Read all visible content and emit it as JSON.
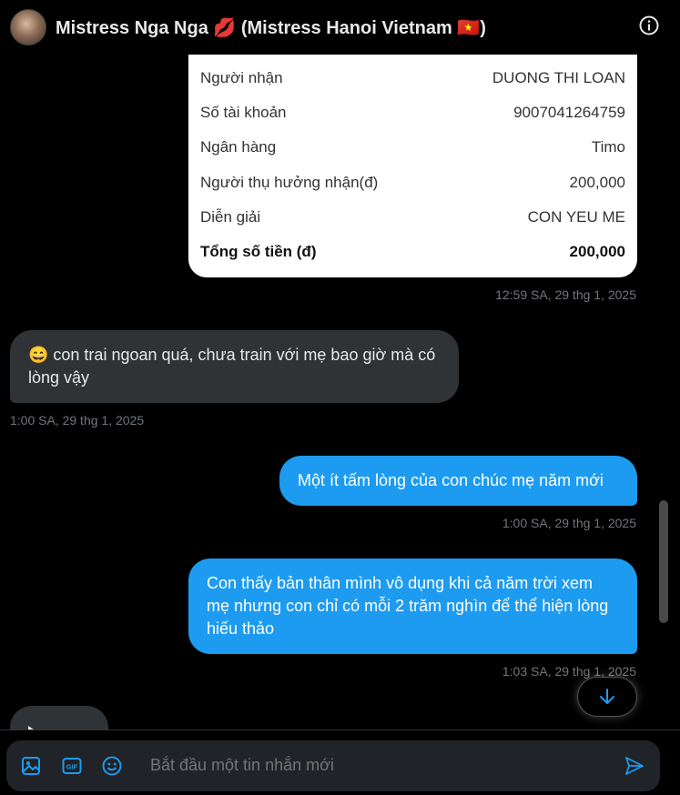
{
  "header": {
    "title": "Mistress Nga Nga 💋 (Mistress Hanoi Vietnam 🇻🇳)",
    "info_icon": "info-icon"
  },
  "transfer_card": {
    "rows": [
      {
        "label": "Người nhận",
        "value": "DUONG THI LOAN"
      },
      {
        "label": "Số tài khoản",
        "value": "9007041264759"
      },
      {
        "label": "Ngân hàng",
        "value": "Timo"
      },
      {
        "label": "Người thụ hưởng nhận(đ)",
        "value": "200,000"
      },
      {
        "label": "Diễn giải",
        "value": "CON YEU ME"
      },
      {
        "label": "Tổng số tiền (đ)",
        "value": "200,000"
      }
    ],
    "timestamp": "12:59 SA, 29 thg 1, 2025"
  },
  "messages": [
    {
      "direction": "in",
      "text": "😄 con trai ngoan quá, chưa train với mẹ bao giờ mà có lòng vậy",
      "timestamp": "1:00 SA, 29 thg 1, 2025"
    },
    {
      "direction": "out",
      "text": "Một ít tấm lòng của con chúc mẹ năm mới",
      "timestamp": "1:00 SA, 29 thg 1, 2025"
    },
    {
      "direction": "out",
      "text": "Con thấy bản thân mình vô dụng khi cả năm trời xem mẹ nhưng con chỉ có mỗi 2 trăm nghìn để thể hiện lòng hiếu thảo",
      "timestamp": "1:03 SA, 29 thg 1, 2025"
    }
  ],
  "composer": {
    "placeholder": "Bắt đầu một tin nhắn mới",
    "tools": [
      "image-icon",
      "gif-icon",
      "emoji-icon"
    ],
    "send_icon": "send-icon"
  },
  "scroll_down_icon": "arrow-down-icon",
  "colors": {
    "background": "#000000",
    "incoming_bubble": "#2f3336",
    "outgoing_bubble": "#1d9bf0",
    "accent": "#1d9bf0",
    "timestamp": "#71767b"
  }
}
